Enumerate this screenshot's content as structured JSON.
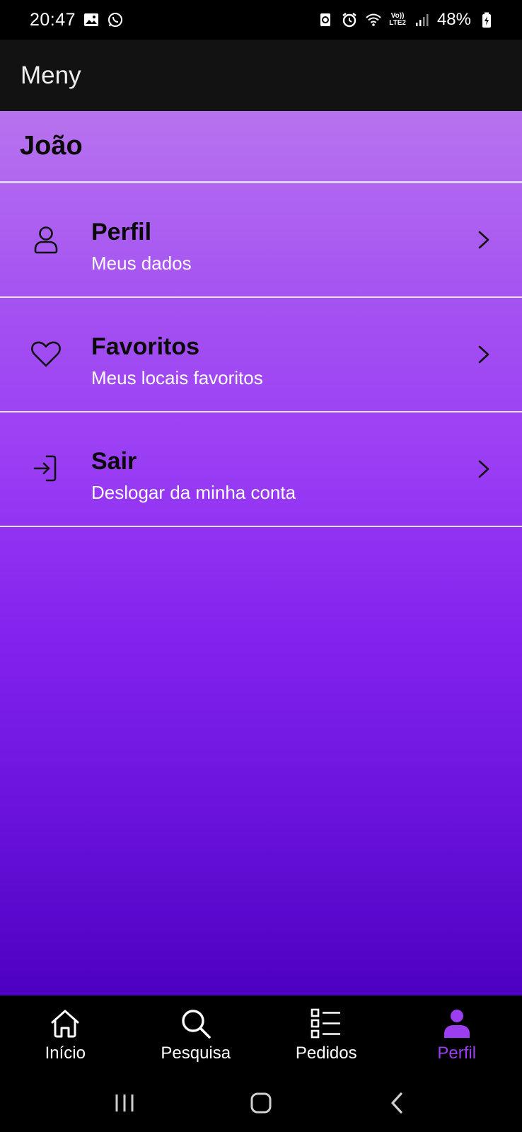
{
  "status_bar": {
    "time": "20:47",
    "battery": "48%",
    "network_label_top": "Vo))",
    "network_label_bottom": "LTE2",
    "left_icons": [
      "gallery-icon",
      "whatsapp-icon"
    ],
    "right_icons": [
      "recycle-icon",
      "alarm-icon",
      "wifi-icon",
      "volte-icon",
      "signal-icon",
      "battery-icon"
    ]
  },
  "app_bar": {
    "title": "Meny"
  },
  "profile": {
    "user_name": "João"
  },
  "menu": {
    "items": [
      {
        "title": "Perfil",
        "subtitle": "Meus dados",
        "icon": "user-icon"
      },
      {
        "title": "Favoritos",
        "subtitle": "Meus locais favoritos",
        "icon": "heart-icon"
      },
      {
        "title": "Sair",
        "subtitle": "Deslogar da minha conta",
        "icon": "logout-icon"
      }
    ]
  },
  "bottom_nav": {
    "tabs": [
      {
        "label": "Início",
        "icon": "home-icon",
        "active": false
      },
      {
        "label": "Pesquisa",
        "icon": "search-icon",
        "active": false
      },
      {
        "label": "Pedidos",
        "icon": "list-icon",
        "active": false
      },
      {
        "label": "Perfil",
        "icon": "person-filled-icon",
        "active": true
      }
    ]
  },
  "colors": {
    "accent": "#9b3ef0",
    "gradient_top": "#b773ee",
    "gradient_bottom": "#4d00c2",
    "app_bar_bg": "#121212"
  }
}
